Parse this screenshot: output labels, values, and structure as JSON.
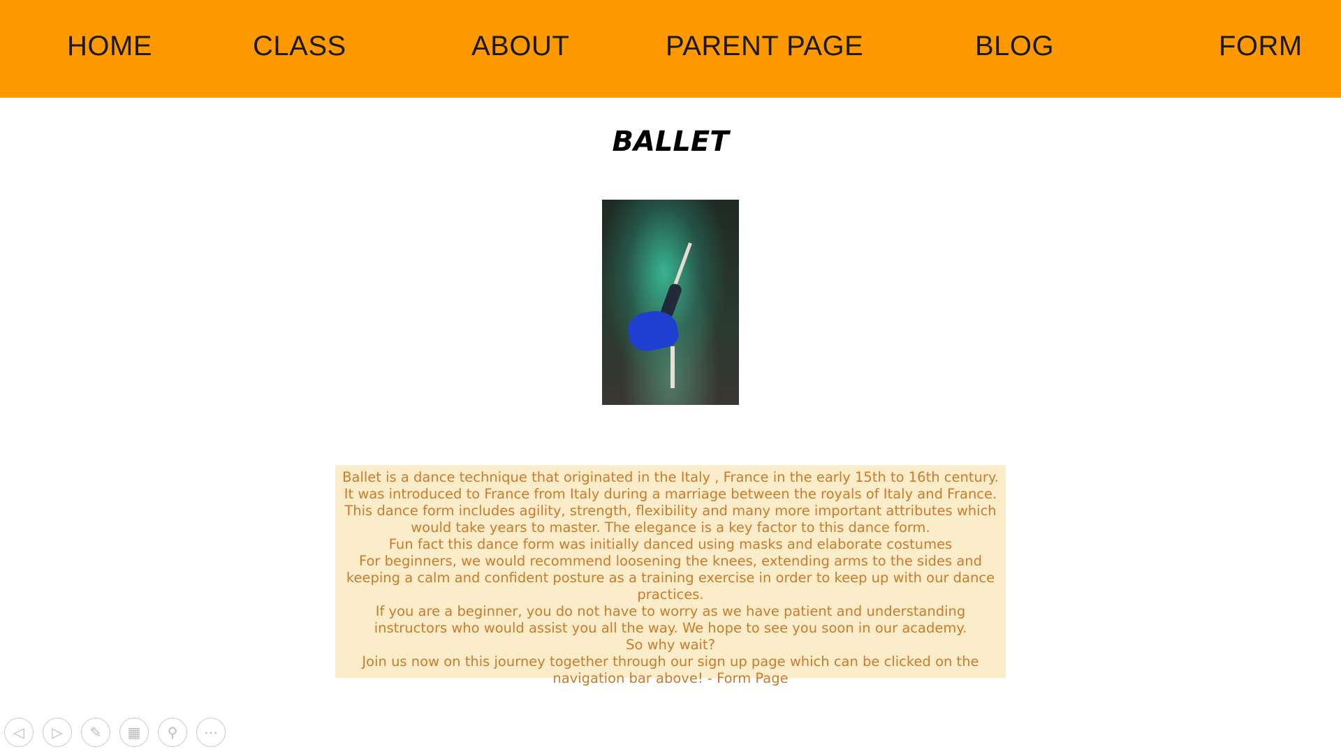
{
  "nav": {
    "items": [
      "HOME",
      "CLASS",
      "ABOUT",
      "PARENT PAGE",
      "BLOG",
      "FORM"
    ]
  },
  "page_title": "BALLET",
  "image": {
    "alt": "ballerina-with-green-smoke"
  },
  "description": [
    "Ballet is a dance technique that originated in the Italy , France in the early 15th to 16th century.",
    "It was introduced to France from Italy during a marriage between the royals of Italy and France.",
    "This dance form includes agility, strength, flexibility and many more important attributes which would take years to master. The elegance is a key factor to this dance form.",
    "Fun fact this dance form was initially danced using masks and elaborate costumes",
    "For beginners, we would recommend loosening the knees, extending arms to the sides and keeping a calm and confident posture as a training exercise in order to keep up with our dance practices.",
    "If you are a beginner, you do not have to worry as we have patient and understanding instructors who would assist you all the way. We hope to see you soon in our academy.",
    "So why wait?",
    "Join us now on this journey together through our sign up page which can be clicked on the navigation bar above! - Form Page"
  ],
  "colors": {
    "nav_bg": "#ff9900",
    "box_bg": "#fcedca",
    "box_text": "#cc7a2a"
  }
}
